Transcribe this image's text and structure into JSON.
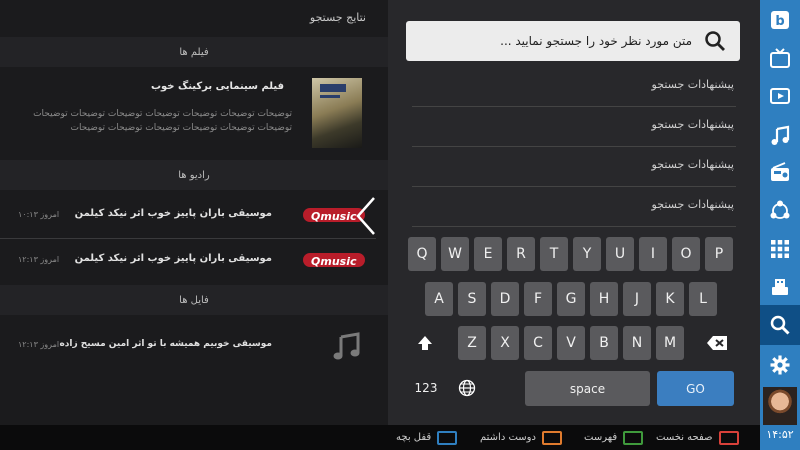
{
  "results": {
    "title": "نتایج جستجو",
    "films_header": "فیلم ها",
    "film": {
      "title": "فیلم سینمایی برکینگ خوب",
      "description": "توضیحات توضیحات توضیحات توضیحات توضیحات توضیحات توضیحات توضیحات توضیحات توضیحات توضیحات توضیحات توضیحات"
    },
    "radios_header": "رادیو ها",
    "radios": [
      {
        "logo": "Qmusic",
        "title": "موسیقی باران پاییز خوب اثر نیکد کیلمن",
        "time": "امروز ۱۰:۱۳"
      },
      {
        "logo": "Qmusic",
        "title": "موسیقی باران پاییز خوب اثر نیکد کیلمن",
        "time": "امروز ۱۲:۱۳"
      }
    ],
    "files_header": "فایل ها",
    "file": {
      "title": "موسیقی خوبیم همیشه با تو اثر امین مسیح زاده",
      "time": "امروز ۱۲:۱۳",
      "icon": "music-note-icon"
    }
  },
  "search": {
    "placeholder": "متن مورد نظر خود را جستجو نمایید ...",
    "suggestions": [
      "پیشنهادات جستجو",
      "پیشنهادات جستجو",
      "پیشنهادات جستجو",
      "پیشنهادات جستجو"
    ]
  },
  "keyboard": {
    "row1": [
      "Q",
      "W",
      "E",
      "R",
      "T",
      "Y",
      "U",
      "I",
      "O",
      "P"
    ],
    "row2": [
      "A",
      "S",
      "D",
      "F",
      "G",
      "H",
      "J",
      "K",
      "L"
    ],
    "row3": [
      "Z",
      "X",
      "C",
      "V",
      "B",
      "N",
      "M"
    ],
    "numbers": "123",
    "space": "space",
    "go": "GO"
  },
  "sidebar": {
    "icons": [
      "bookmark-logo-icon",
      "tv-icon",
      "video-play-icon",
      "music-icon",
      "radio-icon",
      "share-icon",
      "apps-grid-icon",
      "usb-icon",
      "search-icon",
      "settings-icon"
    ],
    "clock": "۱۴:۵۲"
  },
  "legend": [
    {
      "label": "صفحه نخست",
      "color": "#d9413a"
    },
    {
      "label": "فهرست",
      "color": "#3f9a3c"
    },
    {
      "label": "دوست داشتم",
      "color": "#e07b2e"
    },
    {
      "label": "قفل بچه",
      "color": "#2f7fc0"
    }
  ]
}
